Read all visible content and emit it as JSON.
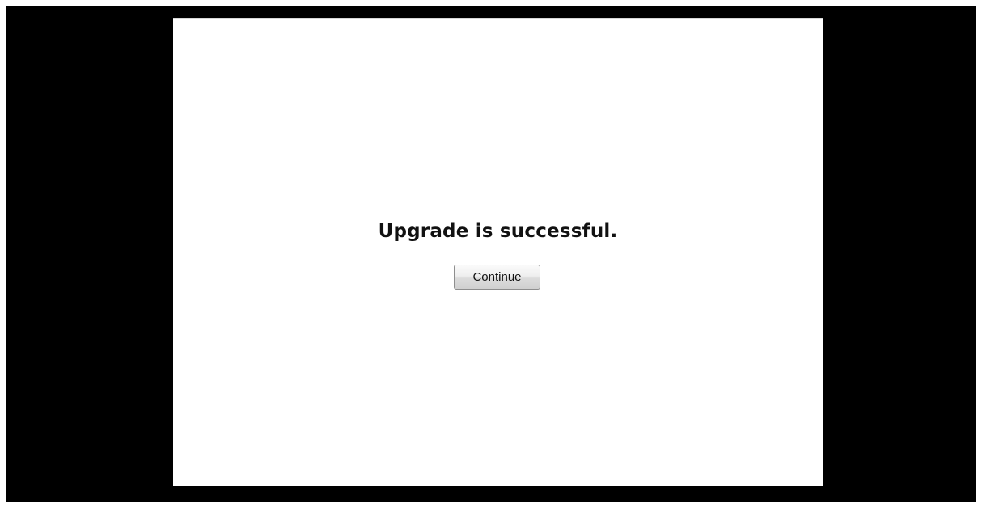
{
  "dialog": {
    "message": "Upgrade is successful.",
    "continue_label": "Continue"
  }
}
